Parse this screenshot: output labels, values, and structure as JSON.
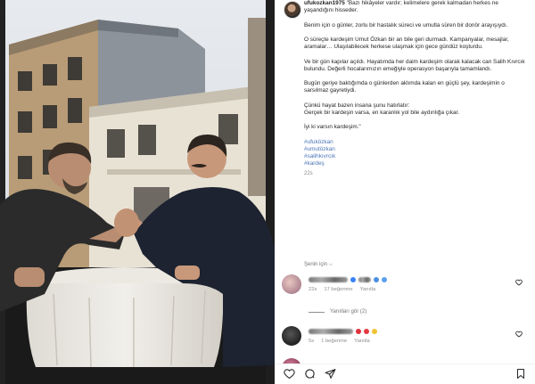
{
  "post": {
    "username": "ufukozkan1975",
    "caption_lines": [
      "\"Bazı hikâyeler vardır; kelimelere gerek kalmadan herkes ne yaşandığını hisseder.",
      "Benim için o günler, zorlu bir hastalık süreci ve umutla süren bir donör arayışıydı.",
      "O süreçte kardeşim Umut Özkan bir an bile geri durmadı. Kampanyalar, mesajlar, aramalar… Ulaşılabilecek herkese ulaşmak için gece gündüz koşturdu.",
      "Ve bir gün kapılar açıldı. Hayatımda her daim kardeşim olarak kalacak can Salih Kıvrcık bulundu. Değerli hocalarımızın emeğiyle operasyon başarıyla tamamlandı.",
      "Bugün geriye baktığımda o günlerden aklımda kalan en güçlü şey, kardeşimin o sarsılmaz gayretiydi.",
      "Çünkü hayat bazen insana şunu hatırlatır:\nGerçek bir kardeşin varsa, en karanlık yol bile aydınlığa çıkar.",
      "İyi ki varsın kardeşim.\""
    ],
    "hashtags": [
      "#ufuközkan",
      "#umutözkan",
      "#salihkıvrcık",
      "#kardeş"
    ],
    "time": "22s",
    "see_translation": "Şenin için ⌵"
  },
  "comments": [
    {
      "time": "22s",
      "likes": "17 beğenme",
      "reply": "Yanıtla",
      "emoji_colors": [
        "#3b82f6",
        "#4a8fe0",
        "#5aa1ef"
      ]
    },
    {
      "time": "5s",
      "likes": "1 beğenme",
      "reply": "Yanıtla",
      "emoji_colors": [
        "#e0303a",
        "#e23a42",
        "#f1c232"
      ]
    }
  ],
  "replies_link": "Yanıtları gör (2)",
  "icons": [
    "heart-icon",
    "comment-icon",
    "share-icon",
    "bookmark-icon"
  ]
}
